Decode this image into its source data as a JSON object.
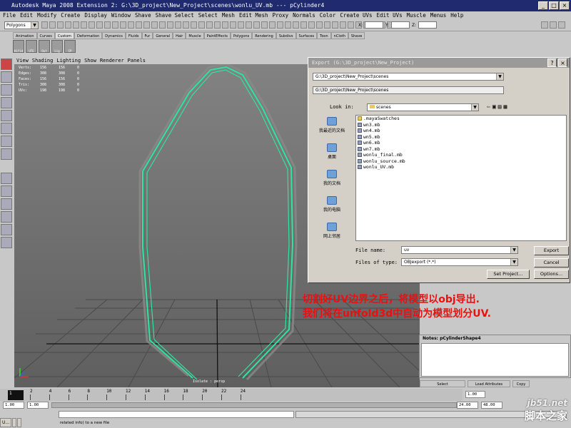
{
  "window": {
    "title": "Autodesk Maya 2008 Extension 2: G:\\3D_project\\New_Project\\scenes\\wonlu_UV.mb  ---  pCylinder4"
  },
  "menu": [
    "File",
    "Edit",
    "Modify",
    "Create",
    "Display",
    "Window",
    "Shave",
    "Shave Select",
    "Select",
    "Mesh",
    "Edit Mesh",
    "Proxy",
    "Normals",
    "Color",
    "Create UVs",
    "Edit UVs",
    "Muscle",
    "Menus",
    "Help"
  ],
  "status": {
    "mode": "Polygons",
    "x_label": "X:",
    "y_label": "Y:",
    "z_label": "Z:"
  },
  "shelf_tabs": [
    "Animation",
    "Curves",
    "Custom",
    "Deformation",
    "Dynamics",
    "Fluids",
    "Fur",
    "General",
    "Hair",
    "Muscle",
    "PaintEffects",
    "Polygons",
    "Rendering",
    "Subdivs",
    "Surfaces",
    "Toon",
    "nCloth",
    "Shave"
  ],
  "shelf_tab_active": "Custom",
  "shelf_icons": [
    "Hifid",
    "UTE",
    "Out",
    "Lig",
    "CP"
  ],
  "viewport": {
    "menu": [
      "View",
      "Shading",
      "Lighting",
      "Show",
      "Renderer",
      "Panels"
    ],
    "hud": [
      {
        "label": "Verts:",
        "a": "156",
        "b": "156",
        "c": "0"
      },
      {
        "label": "Edges:",
        "a": "308",
        "b": "308",
        "c": "0"
      },
      {
        "label": "Faces:",
        "a": "156",
        "b": "156",
        "c": "0"
      },
      {
        "label": "Tris:",
        "a": "308",
        "b": "308",
        "c": "0"
      },
      {
        "label": "UVs:",
        "a": "198",
        "b": "198",
        "c": "0"
      }
    ],
    "camera": "Isolate : persp"
  },
  "caption": {
    "line1": "切割好UV边界之后，将模型以obj导出.",
    "line2": "我们将在unfold3d中自动为模型划分UV."
  },
  "dialog": {
    "title": "Export (G:\\3D_project\\New_Project)",
    "path_combo": "G:\\3D_project\\New_Project\\scenes",
    "path_field": "G:\\3D_project\\New_Project\\scenes",
    "look_in_label": "Look in:",
    "look_in_value": "scenes",
    "places": [
      "我最近的文档",
      "桌面",
      "我的文档",
      "我的电脑",
      "网上邻居"
    ],
    "files": [
      {
        "name": ".mayaSwatches",
        "type": "folder"
      },
      {
        "name": "wn3.mb",
        "type": "file"
      },
      {
        "name": "wn4.mb",
        "type": "file"
      },
      {
        "name": "wn5.mb",
        "type": "file"
      },
      {
        "name": "wn6.mb",
        "type": "file"
      },
      {
        "name": "wn7.mb",
        "type": "file"
      },
      {
        "name": "wonlu_final.mb",
        "type": "file"
      },
      {
        "name": "wonlu_source.mb",
        "type": "file"
      },
      {
        "name": "wonlu_UV.mb",
        "type": "file"
      }
    ],
    "file_name_label": "File name:",
    "file_name_value": "uv",
    "file_type_label": "Files of type:",
    "file_type_value": "OBJexport (*.*)",
    "export_btn": "Export",
    "cancel_btn": "Cancel",
    "set_project_btn": "Set Project...",
    "options_btn": "Options..."
  },
  "notes": {
    "title": "Notes:  pCylinderShape4"
  },
  "attr_buttons": [
    "Select",
    "Load Attributes",
    "Copy"
  ],
  "timeline": {
    "ticks": [
      "2",
      "4",
      "6",
      "8",
      "10",
      "12",
      "14",
      "16",
      "18",
      "20",
      "22",
      "24"
    ],
    "current": "1",
    "start": "1.00",
    "end": "1.00",
    "right_start": "1.00",
    "range_end": "24.00",
    "anim_end": "48.00"
  },
  "taskbar": [
    "U...",
    "",
    ""
  ],
  "help_line": "related info) to a new file",
  "watermark": {
    "line1": "jb51.net",
    "line2": "脚本之家"
  },
  "colors": {
    "title_bar": "#1f2b6e",
    "caption_red": "#ee0e0e",
    "mesh_green": "#2fe3a0",
    "viewport_top": "#828282"
  }
}
